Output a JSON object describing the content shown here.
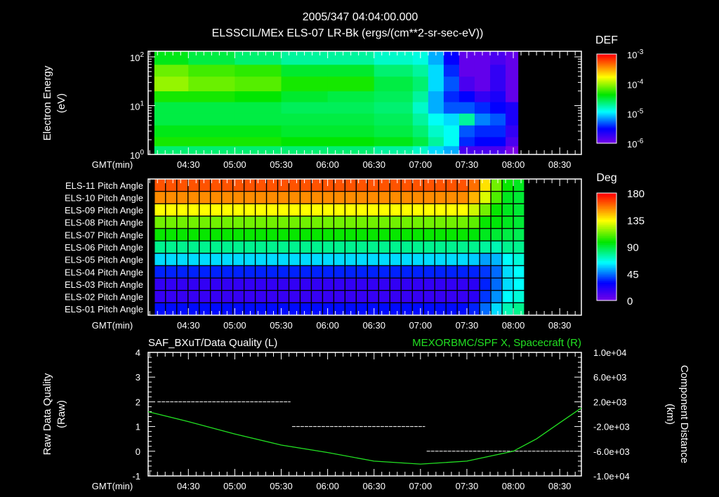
{
  "title": "2005/347 04:04:00.000",
  "chart_data": [
    {
      "type": "heatmap",
      "name": "electron-spectrogram",
      "title": "ELSSCIL/MEx ELS-07 LR-Bk  (ergs/(cm**2-sr-sec-eV))",
      "ylabel": [
        "Electron Energy",
        "(eV)"
      ],
      "xlabel": "GMT(min)",
      "xlim": [
        "04:04",
        "08:44"
      ],
      "ylim": [
        1,
        130
      ],
      "yscale": "log",
      "ytick_labels": [
        {
          "base": "10",
          "exp": "0",
          "value": 1
        },
        {
          "base": "10",
          "exp": "1",
          "value": 10
        },
        {
          "base": "10",
          "exp": "2",
          "value": 100
        }
      ],
      "xtick_labels": [
        "04:30",
        "05:00",
        "05:30",
        "06:00",
        "06:30",
        "07:00",
        "07:30",
        "08:00",
        "08:30"
      ],
      "colorbar": {
        "label": "DEF",
        "range_log10": [
          -6,
          -3
        ],
        "tick_labels": [
          {
            "base": "10",
            "exp": "-3",
            "value": -3
          },
          {
            "base": "10",
            "exp": "-4",
            "value": -4
          },
          {
            "base": "10",
            "exp": "-5",
            "value": -5
          },
          {
            "base": "10",
            "exp": "-6",
            "value": -6
          }
        ]
      },
      "time_edges": [
        "04:08",
        "04:30",
        "05:00",
        "05:30",
        "06:00",
        "06:30",
        "06:55",
        "07:05",
        "07:15",
        "07:25",
        "07:35",
        "07:45",
        "07:55",
        "08:03"
      ],
      "energy_edges": [
        1,
        1.5,
        2.3,
        4,
        7,
        12,
        20,
        40,
        70,
        130
      ],
      "log10_values": [
        [
          -4.6,
          -4.6,
          -4.6,
          -4.6,
          -4.6,
          -4.7,
          -4.8,
          -5.0,
          -5.1,
          -5.8,
          -5.8,
          -5.8,
          -6.0
        ],
        [
          -4.3,
          -4.3,
          -4.3,
          -4.35,
          -4.35,
          -4.4,
          -4.5,
          -4.7,
          -4.9,
          -5.4,
          -5.5,
          -5.5,
          -5.8
        ],
        [
          -4.4,
          -4.4,
          -4.4,
          -4.45,
          -4.45,
          -4.5,
          -4.6,
          -4.8,
          -4.9,
          -5.3,
          -5.4,
          -5.4,
          -5.7
        ],
        [
          -4.5,
          -4.5,
          -4.5,
          -4.5,
          -4.5,
          -4.55,
          -4.7,
          -4.9,
          -5.0,
          -4.7,
          -5.2,
          -5.3,
          -5.6
        ],
        [
          -4.5,
          -4.5,
          -4.5,
          -4.55,
          -4.55,
          -4.6,
          -4.8,
          -5.1,
          -5.3,
          -5.3,
          -5.4,
          -5.5,
          -5.6
        ],
        [
          -4.3,
          -4.3,
          -4.35,
          -4.45,
          -4.5,
          -4.55,
          -4.7,
          -5.1,
          -5.4,
          -5.5,
          -5.7,
          -5.6,
          -5.9
        ],
        [
          -4.0,
          -4.1,
          -4.15,
          -4.3,
          -4.3,
          -4.5,
          -4.6,
          -5.0,
          -5.3,
          -5.8,
          -5.9,
          -5.7,
          -5.9
        ],
        [
          -4.1,
          -4.2,
          -4.25,
          -4.45,
          -4.45,
          -4.6,
          -4.7,
          -5.0,
          -5.4,
          -5.9,
          -5.9,
          -5.7,
          -5.9
        ],
        [
          -4.4,
          -4.5,
          -4.6,
          -4.7,
          -4.7,
          -4.8,
          -4.85,
          -5.1,
          -5.5,
          -5.9,
          -5.9,
          -5.8,
          -5.9
        ]
      ]
    },
    {
      "type": "heatmap",
      "name": "pitch-angle",
      "xlabel": "GMT(min)",
      "xlim": [
        "04:04",
        "08:44"
      ],
      "xtick_labels": [
        "04:30",
        "05:00",
        "05:30",
        "06:00",
        "06:30",
        "07:00",
        "07:30",
        "08:00",
        "08:30"
      ],
      "colorbar": {
        "label": "Deg",
        "range": [
          0,
          180
        ],
        "tick_labels": [
          "180",
          "135",
          "90",
          "45",
          "0"
        ]
      },
      "column_start": "04:08",
      "column_minutes": 7.25,
      "columns": 33,
      "rows": [
        {
          "label": "ELS-11 Pitch Angle",
          "value": 165,
          "final_values": [
            160,
            140,
            115,
            100,
            95
          ]
        },
        {
          "label": "ELS-10 Pitch Angle",
          "value": 155,
          "final_values": [
            148,
            130,
            110,
            95,
            92
          ]
        },
        {
          "label": "ELS-09 Pitch Angle",
          "value": 135,
          "final_values": [
            128,
            115,
            100,
            95,
            92
          ]
        },
        {
          "label": "ELS-08 Pitch Angle",
          "value": 115,
          "final_values": [
            112,
            100,
            98,
            95,
            92
          ]
        },
        {
          "label": "ELS-07 Pitch Angle",
          "value": 100,
          "final_values": [
            98,
            95,
            92,
            90,
            88
          ]
        },
        {
          "label": "ELS-06 Pitch Angle",
          "value": 80,
          "final_values": [
            80,
            78,
            75,
            80,
            80
          ]
        },
        {
          "label": "ELS-05 Pitch Angle",
          "value": 60,
          "final_values": [
            58,
            52,
            55,
            65,
            70
          ]
        },
        {
          "label": "ELS-04 Pitch Angle",
          "value": 35,
          "final_values": [
            35,
            38,
            45,
            60,
            65
          ]
        },
        {
          "label": "ELS-03 Pitch Angle",
          "value": 18,
          "final_values": [
            20,
            35,
            45,
            60,
            65
          ]
        },
        {
          "label": "ELS-02 Pitch Angle",
          "value": 17,
          "final_values": [
            20,
            38,
            50,
            65,
            70
          ]
        },
        {
          "label": "ELS-01 Pitch Angle",
          "value": 32,
          "final_values": [
            35,
            45,
            60,
            75,
            80
          ]
        }
      ]
    },
    {
      "type": "line",
      "name": "quality-and-position",
      "left_title": "SAF_BXuT/Data Quality (L)",
      "right_title": "MEXORBMC/SPF X, Spacecraft (R)",
      "left_ylabel": [
        "Raw Data Quality",
        "(Raw)"
      ],
      "right_ylabel": [
        "Component Distance",
        "(km)"
      ],
      "xlabel": "GMT(min)",
      "xlim": [
        "04:04",
        "08:44"
      ],
      "left_ylim": [
        -1,
        4
      ],
      "right_ylim": [
        -10000,
        10000
      ],
      "left_tick_labels": [
        "4",
        "3",
        "2",
        "1",
        "0",
        "-1"
      ],
      "right_tick_labels": [
        "1.0e+04",
        "6.0e+03",
        "2.0e+03",
        "-2.0e+03",
        "-6.0e+03",
        "-1.0e+04"
      ],
      "xtick_labels": [
        "04:30",
        "05:00",
        "05:30",
        "06:00",
        "06:30",
        "07:00",
        "07:30",
        "08:00",
        "08:30"
      ],
      "colors": {
        "quality": "#ffffff",
        "position": "#22e022"
      },
      "quality_segments": [
        {
          "start": "04:10",
          "end": "05:36",
          "value": 2
        },
        {
          "start": "05:37",
          "end": "07:03",
          "value": 1
        },
        {
          "start": "07:04",
          "end": "08:40",
          "value": 0
        }
      ],
      "position_series": {
        "time": [
          "04:04",
          "04:30",
          "05:00",
          "05:30",
          "06:00",
          "06:30",
          "07:00",
          "07:30",
          "08:00",
          "08:15",
          "08:30",
          "08:44"
        ],
        "value_km": [
          400,
          -1200,
          -3200,
          -5000,
          -6200,
          -7600,
          -8080,
          -7600,
          -6000,
          -4000,
          -1400,
          1000
        ]
      }
    }
  ]
}
